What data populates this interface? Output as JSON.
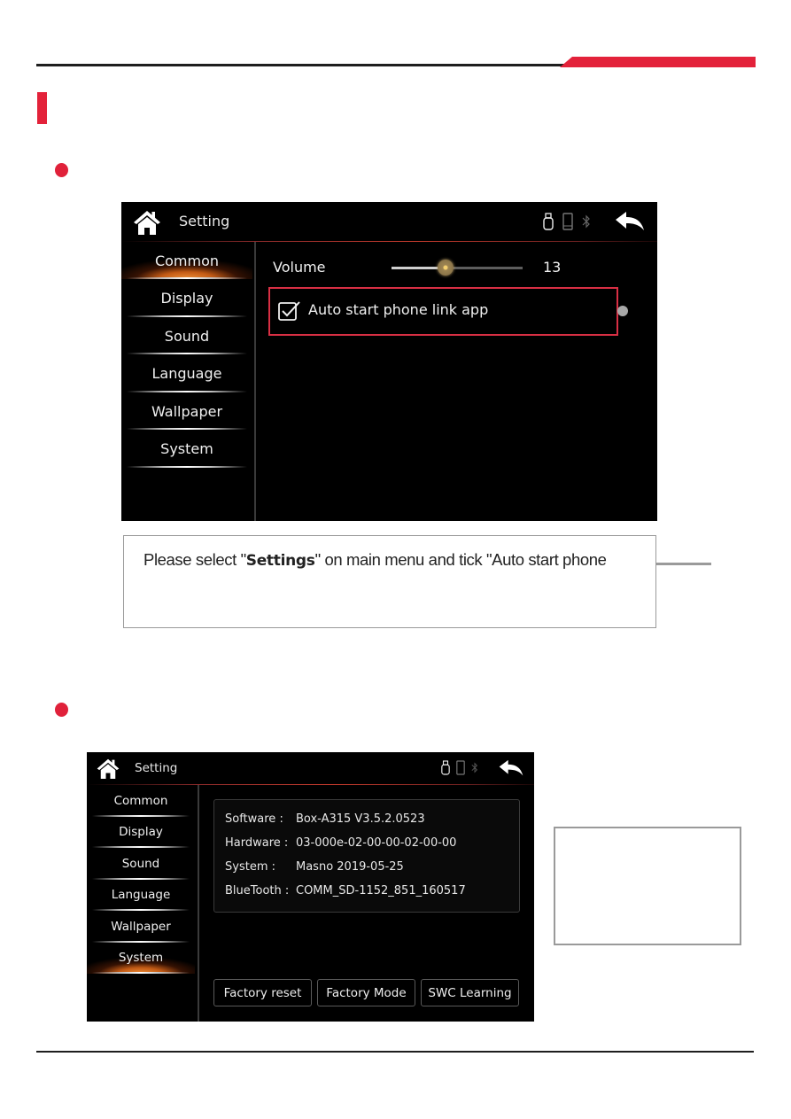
{
  "colors": {
    "accent_red": "#e3223a",
    "highlight_border": "#d82f44",
    "screen_bg": "#000000",
    "active_glow": "#f0913a"
  },
  "screen_common": {
    "title": "Setting",
    "icons": {
      "home": "home-icon",
      "usb": "usb-icon",
      "phone": "phone-icon",
      "bluetooth": "bluetooth-icon",
      "back": "back-arrow-icon"
    },
    "sidebar": {
      "active": "Common",
      "items": [
        {
          "label": "Common"
        },
        {
          "label": "Display"
        },
        {
          "label": "Sound"
        },
        {
          "label": "Language"
        },
        {
          "label": "Wallpaper"
        },
        {
          "label": "System"
        }
      ]
    },
    "volume": {
      "label": "Volume",
      "value": "13",
      "slider_fraction": 0.41
    },
    "auto_start": {
      "label": "Auto start phone link app",
      "checked": true
    }
  },
  "caption": {
    "prefix": "Please select \"",
    "bold": "Settings",
    "suffix": "\" on main menu and tick \"Auto start phone"
  },
  "screen_system": {
    "title": "Setting",
    "sidebar": {
      "active": "System",
      "items": [
        {
          "label": "Common"
        },
        {
          "label": "Display"
        },
        {
          "label": "Sound"
        },
        {
          "label": "Language"
        },
        {
          "label": "Wallpaper"
        },
        {
          "label": "System"
        }
      ]
    },
    "info": [
      {
        "key": "Software :",
        "value": "Box-A315 V3.5.2.0523"
      },
      {
        "key": "Hardware :",
        "value": "03-000e-02-00-00-02-00-00"
      },
      {
        "key": "System :",
        "value": "Masno 2019-05-25"
      },
      {
        "key": "BlueTooth :",
        "value": "COMM_SD-1152_851_160517"
      }
    ],
    "buttons": [
      {
        "label": "Factory reset"
      },
      {
        "label": "Factory Mode"
      },
      {
        "label": "SWC Learning"
      }
    ]
  }
}
